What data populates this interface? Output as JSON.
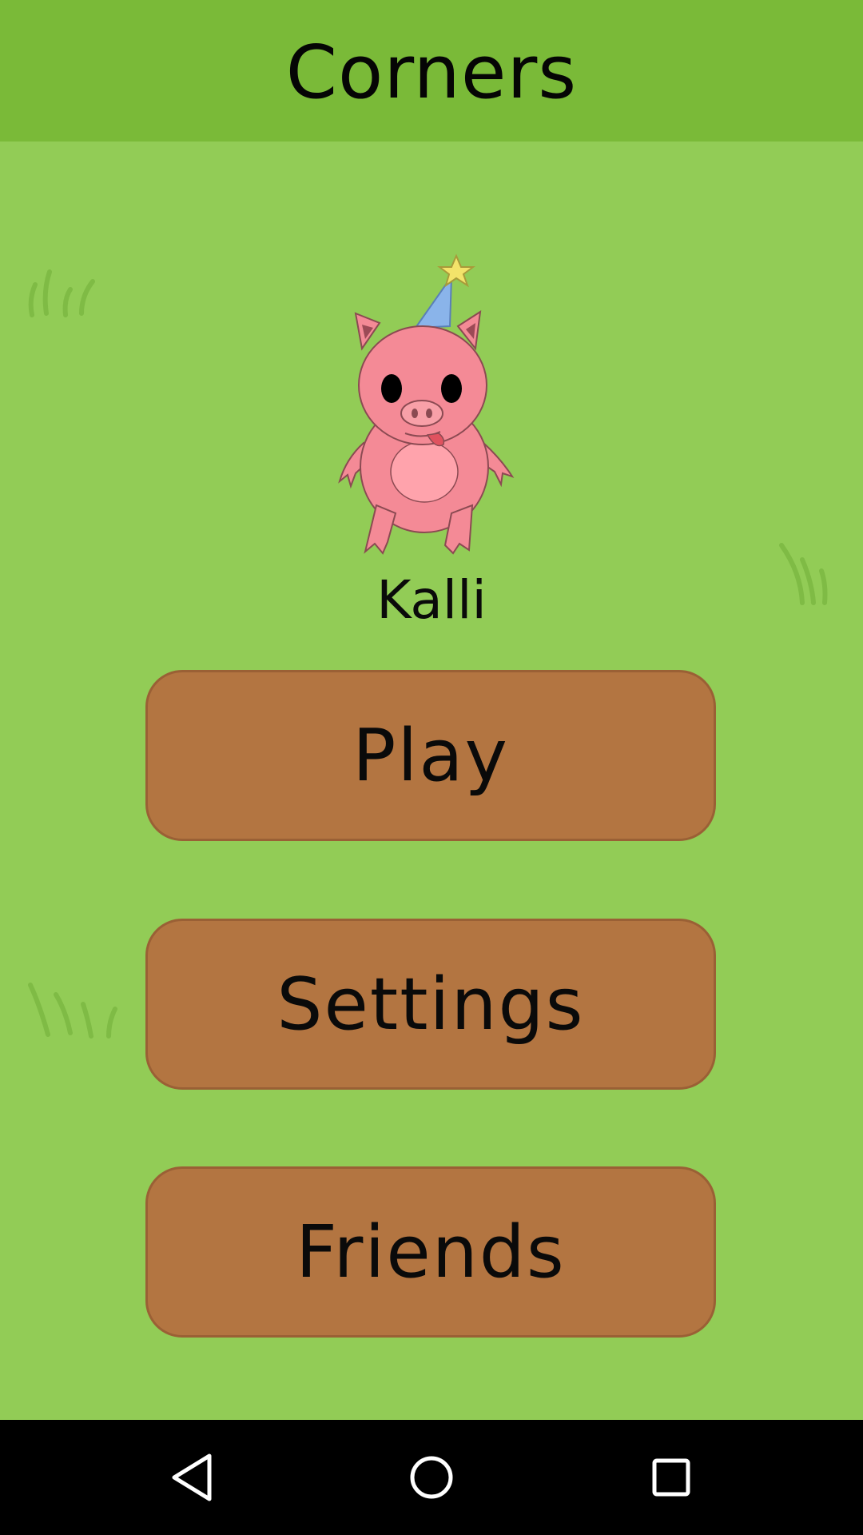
{
  "app": {
    "title": "Corners"
  },
  "character": {
    "name": "Kalli",
    "image": "pig-with-party-hat"
  },
  "menu": {
    "play_label": "Play",
    "settings_label": "Settings",
    "friends_label": "Friends"
  },
  "navbar": {
    "back_icon": "triangle-back-icon",
    "home_icon": "circle-home-icon",
    "recents_icon": "square-recents-icon"
  },
  "colors": {
    "background": "#92cc56",
    "header": "#7aba38",
    "button": "#b37541",
    "button_border": "#9a6035",
    "navbar": "#000000"
  }
}
